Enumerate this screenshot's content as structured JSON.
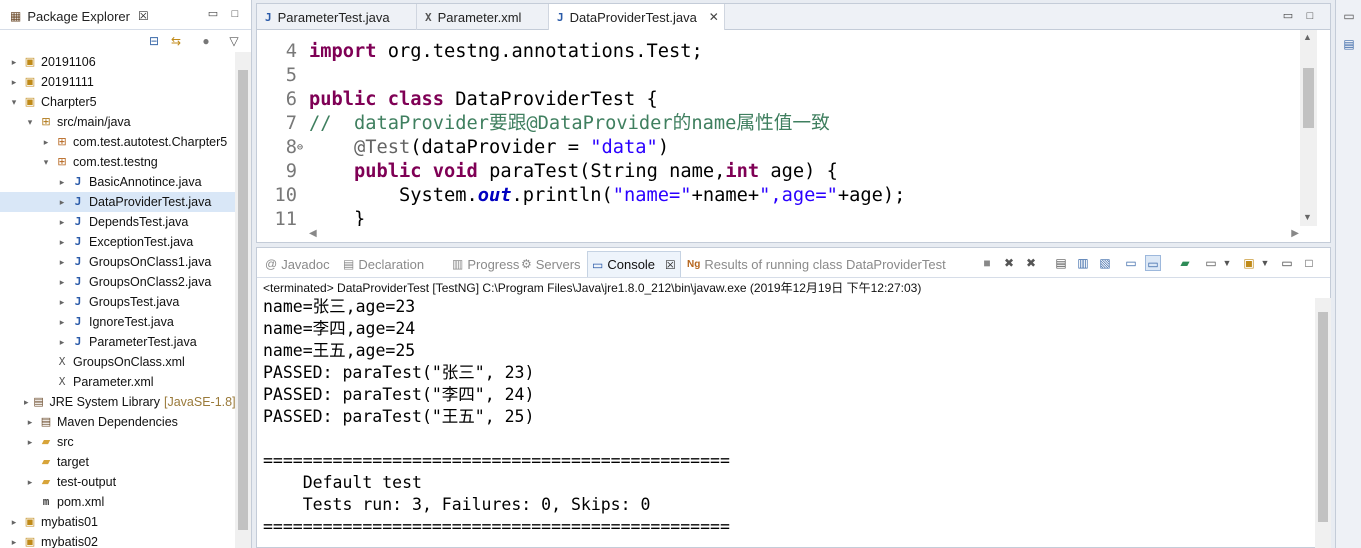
{
  "explorer": {
    "title": "Package Explorer",
    "close_glyph": "☒",
    "items": [
      {
        "label": "20191106",
        "decoration": "",
        "icon": "project-icon",
        "glyph": "▣",
        "cls": "ico-proj",
        "depth": 0,
        "twisty": "▸",
        "selected": false
      },
      {
        "label": "20191111",
        "decoration": "",
        "icon": "project-icon",
        "glyph": "▣",
        "cls": "ico-proj",
        "depth": 0,
        "twisty": "▸",
        "selected": false
      },
      {
        "label": "Charpter5",
        "decoration": "",
        "icon": "project-icon",
        "glyph": "▣",
        "cls": "ico-proj",
        "depth": 0,
        "twisty": "▾",
        "selected": false
      },
      {
        "label": "src/main/java",
        "decoration": "",
        "icon": "source-folder-icon",
        "glyph": "⊞",
        "cls": "ico-pkgroot",
        "depth": 1,
        "twisty": "▾",
        "selected": false
      },
      {
        "label": "com.test.autotest.Charpter5",
        "decoration": "",
        "icon": "package-icon",
        "glyph": "⊞",
        "cls": "ico-pkg",
        "depth": 2,
        "twisty": "▸",
        "selected": false
      },
      {
        "label": "com.test.testng",
        "decoration": "",
        "icon": "package-icon",
        "glyph": "⊞",
        "cls": "ico-pkg",
        "depth": 2,
        "twisty": "▾",
        "selected": false
      },
      {
        "label": "BasicAnnotince.java",
        "decoration": "",
        "icon": "java-file-icon",
        "glyph": "J",
        "cls": "ico-java",
        "depth": 3,
        "twisty": "▸",
        "selected": false
      },
      {
        "label": "DataProviderTest.java",
        "decoration": "",
        "icon": "java-file-icon",
        "glyph": "J",
        "cls": "ico-java",
        "depth": 3,
        "twisty": "▸",
        "selected": true
      },
      {
        "label": "DependsTest.java",
        "decoration": "",
        "icon": "java-file-icon",
        "glyph": "J",
        "cls": "ico-java",
        "depth": 3,
        "twisty": "▸",
        "selected": false
      },
      {
        "label": "ExceptionTest.java",
        "decoration": "",
        "icon": "java-file-icon",
        "glyph": "J",
        "cls": "ico-java",
        "depth": 3,
        "twisty": "▸",
        "selected": false
      },
      {
        "label": "GroupsOnClass1.java",
        "decoration": "",
        "icon": "java-file-icon",
        "glyph": "J",
        "cls": "ico-java",
        "depth": 3,
        "twisty": "▸",
        "selected": false
      },
      {
        "label": "GroupsOnClass2.java",
        "decoration": "",
        "icon": "java-file-icon",
        "glyph": "J",
        "cls": "ico-java",
        "depth": 3,
        "twisty": "▸",
        "selected": false
      },
      {
        "label": "GroupsTest.java",
        "decoration": "",
        "icon": "java-file-icon",
        "glyph": "J",
        "cls": "ico-java",
        "depth": 3,
        "twisty": "▸",
        "selected": false
      },
      {
        "label": "IgnoreTest.java",
        "decoration": "",
        "icon": "java-file-icon",
        "glyph": "J",
        "cls": "ico-java",
        "depth": 3,
        "twisty": "▸",
        "selected": false
      },
      {
        "label": "ParameterTest.java",
        "decoration": "",
        "icon": "java-file-icon",
        "glyph": "J",
        "cls": "ico-java",
        "depth": 3,
        "twisty": "▸",
        "selected": false
      },
      {
        "label": "GroupsOnClass.xml",
        "decoration": "",
        "icon": "xml-file-icon",
        "glyph": "X",
        "cls": "ico-xml",
        "depth": 2,
        "twisty": "",
        "selected": false
      },
      {
        "label": "Parameter.xml",
        "decoration": "",
        "icon": "xml-file-icon",
        "glyph": "X",
        "cls": "ico-xml",
        "depth": 2,
        "twisty": "",
        "selected": false
      },
      {
        "label": "JRE System Library",
        "decoration": "[JavaSE-1.8]",
        "icon": "library-icon",
        "glyph": "▤",
        "cls": "ico-lib",
        "depth": 1,
        "twisty": "▸",
        "selected": false
      },
      {
        "label": "Maven Dependencies",
        "decoration": "",
        "icon": "library-icon",
        "glyph": "▤",
        "cls": "ico-lib",
        "depth": 1,
        "twisty": "▸",
        "selected": false
      },
      {
        "label": "src",
        "decoration": "",
        "icon": "folder-icon",
        "glyph": "▰",
        "cls": "ico-folder",
        "depth": 1,
        "twisty": "▸",
        "selected": false
      },
      {
        "label": "target",
        "decoration": "",
        "icon": "folder-icon",
        "glyph": "▰",
        "cls": "ico-folder",
        "depth": 1,
        "twisty": "",
        "selected": false
      },
      {
        "label": "test-output",
        "decoration": "",
        "icon": "folder-icon",
        "glyph": "▰",
        "cls": "ico-folder",
        "depth": 1,
        "twisty": "▸",
        "selected": false
      },
      {
        "label": "pom.xml",
        "decoration": "",
        "icon": "maven-pom-icon",
        "glyph": "m",
        "cls": "ico-m",
        "depth": 1,
        "twisty": "",
        "selected": false
      },
      {
        "label": "mybatis01",
        "decoration": "",
        "icon": "project-icon",
        "glyph": "▣",
        "cls": "ico-proj",
        "depth": 0,
        "twisty": "▸",
        "selected": false
      },
      {
        "label": "mybatis02",
        "decoration": "",
        "icon": "project-icon",
        "glyph": "▣",
        "cls": "ico-proj",
        "depth": 0,
        "twisty": "▸",
        "selected": false
      }
    ]
  },
  "editor": {
    "tabs": [
      {
        "label": "ParameterTest.java",
        "glyph": "J",
        "active": false,
        "close": ""
      },
      {
        "label": "Parameter.xml",
        "glyph": "X",
        "active": false,
        "close": ""
      },
      {
        "label": "DataProviderTest.java",
        "glyph": "J",
        "active": true,
        "close": "✕"
      }
    ],
    "lines": [
      {
        "num": "4",
        "fold": "",
        "segments": [
          {
            "t": "import",
            "c": "kw"
          },
          {
            "t": " org.testng.annotations.Test;",
            "c": ""
          }
        ]
      },
      {
        "num": "5",
        "fold": "",
        "segments": []
      },
      {
        "num": "6",
        "fold": "",
        "segments": [
          {
            "t": "public",
            "c": "kw"
          },
          {
            "t": " ",
            "c": ""
          },
          {
            "t": "class",
            "c": "kw"
          },
          {
            "t": " DataProviderTest {",
            "c": ""
          }
        ]
      },
      {
        "num": "7",
        "fold": "",
        "segments": [
          {
            "t": "//  dataProvider要跟@DataProvider的name属性值一致",
            "c": "cmt"
          }
        ]
      },
      {
        "num": "8",
        "fold": "⊖",
        "segments": [
          {
            "t": "    ",
            "c": ""
          },
          {
            "t": "@Test",
            "c": "ann"
          },
          {
            "t": "(dataProvider = ",
            "c": ""
          },
          {
            "t": "\"data\"",
            "c": "str"
          },
          {
            "t": ")",
            "c": ""
          }
        ]
      },
      {
        "num": "9",
        "fold": "",
        "segments": [
          {
            "t": "    ",
            "c": ""
          },
          {
            "t": "public",
            "c": "kw"
          },
          {
            "t": " ",
            "c": ""
          },
          {
            "t": "void",
            "c": "kw"
          },
          {
            "t": " paraTest(String name,",
            "c": ""
          },
          {
            "t": "int",
            "c": "kw"
          },
          {
            "t": " age) {",
            "c": ""
          }
        ]
      },
      {
        "num": "10",
        "fold": "",
        "segments": [
          {
            "t": "        System.",
            "c": ""
          },
          {
            "t": "out",
            "c": "fld"
          },
          {
            "t": ".println(",
            "c": ""
          },
          {
            "t": "\"name=\"",
            "c": "str"
          },
          {
            "t": "+name+",
            "c": ""
          },
          {
            "t": "\",age=\"",
            "c": "str"
          },
          {
            "t": "+age);",
            "c": ""
          }
        ]
      },
      {
        "num": "11",
        "fold": "",
        "segments": [
          {
            "t": "    }",
            "c": ""
          }
        ]
      }
    ]
  },
  "console": {
    "tabs": [
      {
        "label": "Javadoc",
        "glyph": "@",
        "active": false,
        "name": "tab-javadoc",
        "icon": "javadoc-icon"
      },
      {
        "label": "Declaration",
        "glyph": "▤",
        "active": false,
        "name": "tab-declaration",
        "icon": "declaration-icon"
      },
      {
        "label": "Progress",
        "glyph": "▥",
        "active": false,
        "name": "tab-progress",
        "icon": "progress-icon"
      },
      {
        "label": "Servers",
        "glyph": "⚙",
        "active": false,
        "name": "tab-servers",
        "icon": "servers-icon"
      },
      {
        "label": "Console",
        "glyph": "▭",
        "active": true,
        "name": "tab-console",
        "icon": "console-icon"
      },
      {
        "label": "Results of running class DataProviderTest",
        "glyph": "Ng",
        "active": false,
        "name": "tab-testng-results",
        "icon": "testng-icon"
      }
    ],
    "terminated": "<terminated> DataProviderTest [TestNG] C:\\Program Files\\Java\\jre1.8.0_212\\bin\\javaw.exe (2019年12月19日 下午12:27:03)",
    "output": [
      "name=张三,age=23",
      "name=李四,age=24",
      "name=王五,age=25",
      "PASSED: paraTest(\"张三\", 23)",
      "PASSED: paraTest(\"李四\", 24)",
      "PASSED: paraTest(\"王五\", 25)",
      "",
      "===============================================",
      "    Default test",
      "    Tests run: 3, Failures: 0, Skips: 0",
      "==============================================="
    ]
  }
}
